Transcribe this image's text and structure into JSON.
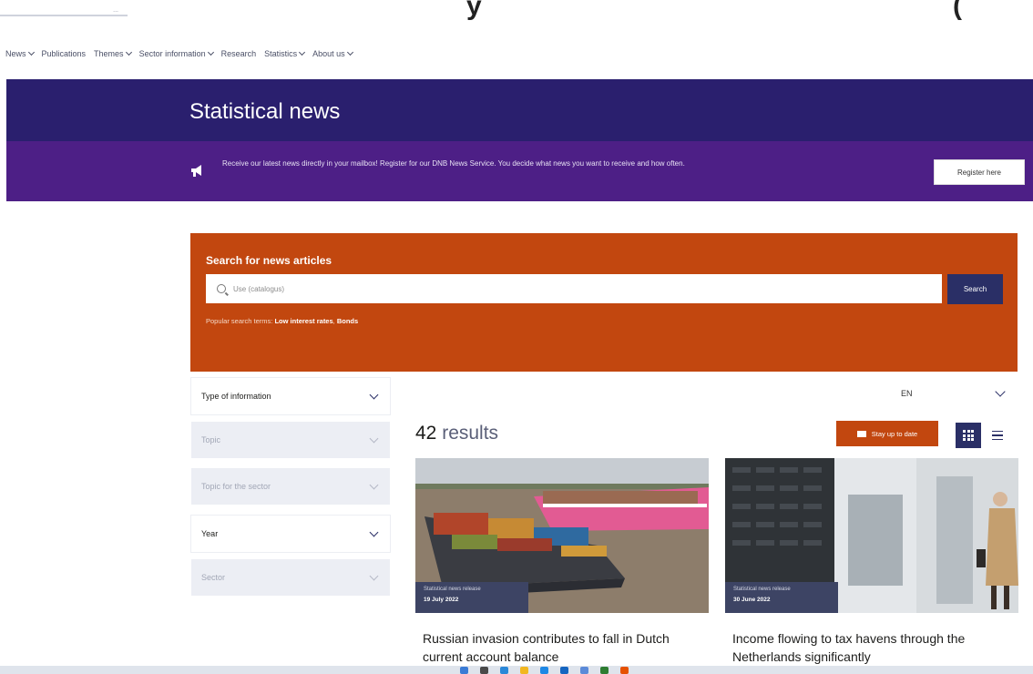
{
  "header": {
    "logo_text": "...",
    "partial_heading": "y",
    "partial_heading_right": "("
  },
  "nav": {
    "items": [
      {
        "label": "News",
        "has_dropdown": true
      },
      {
        "label": "Publications",
        "has_dropdown": false
      },
      {
        "label": "Themes",
        "has_dropdown": true
      },
      {
        "label": "Sector information",
        "has_dropdown": true
      },
      {
        "label": "Research",
        "has_dropdown": false
      },
      {
        "label": "Statistics",
        "has_dropdown": true
      },
      {
        "label": "About us",
        "has_dropdown": true
      }
    ]
  },
  "hero": {
    "title": "Statistical news"
  },
  "announcement": {
    "icon": "megaphone-icon",
    "text": "Receive our latest news directly in your mailbox! Register for our DNB News Service. You decide what news you want to receive and how often.",
    "button_label": "Register here"
  },
  "search": {
    "heading": "Search for news articles",
    "placeholder": "Use (catalogus)",
    "button_label": "Search",
    "popular_prefix": "Popular search terms:",
    "popular_terms": [
      "Low interest rates",
      "Bonds"
    ]
  },
  "filters": [
    {
      "label": "Type of information",
      "state": "active"
    },
    {
      "label": "Topic",
      "state": "muted"
    },
    {
      "label": "Topic for the sector",
      "state": "muted"
    },
    {
      "label": "Year",
      "state": "active"
    },
    {
      "label": "Sector",
      "state": "muted"
    }
  ],
  "sort": {
    "value": "EN"
  },
  "results": {
    "count": "42",
    "word": "results",
    "stay_updated_label": "Stay up to date"
  },
  "cards": [
    {
      "category": "Statistical news release",
      "date": "19 July 2022",
      "title": "Russian invasion contributes to fall in Dutch current account balance"
    },
    {
      "category": "Statistical news release",
      "date": "30 June 2022",
      "title": "Income flowing to tax havens through the Netherlands significantly"
    }
  ],
  "colors": {
    "hero_bg": "#2a1f6e",
    "announce_bg": "#4d1f86",
    "search_bg": "#c2470f",
    "accent_navy": "#2a2f66",
    "tag_bg": "#3d4464"
  }
}
